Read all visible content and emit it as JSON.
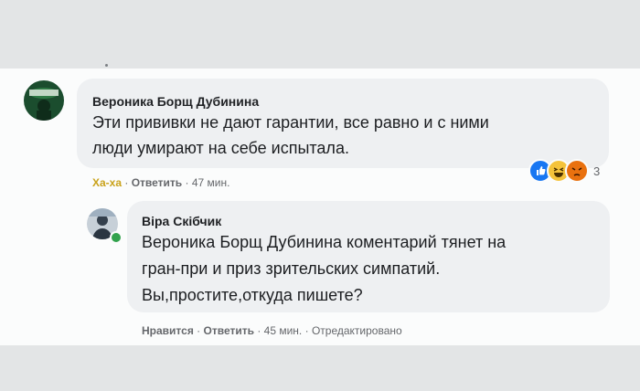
{
  "comments": [
    {
      "author": "Вероника Борщ Дубинина",
      "text_lines": [
        "Эти прививки не дают гарантии, все равно и с ними",
        "люди умирают на себе испытала."
      ],
      "actions": {
        "reaction_label": "Ха-ха",
        "reply_label": "Ответить",
        "time": "47 мин."
      },
      "reactions": {
        "icons": [
          "like-icon",
          "haha-icon",
          "angry-icon"
        ],
        "count": "3"
      }
    },
    {
      "author": "Віра Скібчик",
      "text_lines": [
        "Вероника Борщ Дубинина коментарий тянет на",
        "гран-при и приз зрительских симпатий.",
        "Вы,простите,откуда пишете?"
      ],
      "actions": {
        "like_label": "Нравится",
        "reply_label": "Ответить",
        "time": "45 мин.",
        "edited_label": "Отредактировано"
      }
    }
  ],
  "colors": {
    "page_background": "#e3e5e6",
    "card_background": "#fbfcfc",
    "bubble_background": "#eef0f2",
    "haha_reaction": "#c9a21a",
    "like_blue": "#1877f2"
  }
}
